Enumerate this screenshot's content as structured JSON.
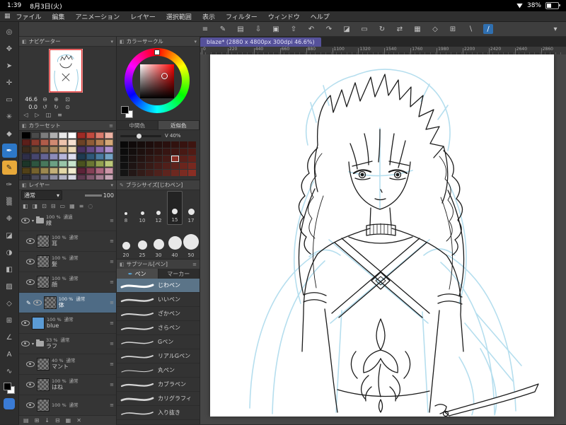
{
  "ui": {
    "chevron_down": "▾",
    "panel_icon": "◧",
    "menu_grid_icon": "▦",
    "list_icon": "≡",
    "dropdown_arrow": "▾",
    "pen_nib_icon": "✒",
    "pencil_icon": "✎"
  },
  "status_bar": {
    "time": "1:39",
    "date": "8月3日(火)",
    "battery_percent": "38%"
  },
  "menu_bar": {
    "items": [
      "ファイル",
      "編集",
      "アニメーション",
      "レイヤー",
      "選択範囲",
      "表示",
      "フィルター",
      "ウィンドウ",
      "ヘルプ"
    ]
  },
  "toolbar": {
    "icons": [
      {
        "name": "main-menu-icon",
        "glyph": "≡"
      },
      {
        "name": "pen-touch-toggle-icon",
        "glyph": "✎"
      },
      {
        "name": "new-canvas-icon",
        "glyph": "▤"
      },
      {
        "name": "import-icon",
        "glyph": "⇩"
      },
      {
        "name": "save-icon",
        "glyph": "▣"
      },
      {
        "name": "export-icon",
        "glyph": "⇧"
      },
      {
        "name": "undo-icon",
        "glyph": "↶"
      },
      {
        "name": "redo-icon",
        "glyph": "↷"
      },
      {
        "name": "clear-icon",
        "glyph": "◪"
      },
      {
        "name": "deselect-icon",
        "glyph": "▭"
      },
      {
        "name": "rotate-canvas-icon",
        "glyph": "↻"
      },
      {
        "name": "flip-canvas-icon",
        "glyph": "⇄"
      },
      {
        "name": "grid-icon",
        "glyph": "▦"
      },
      {
        "name": "snap-icon",
        "glyph": "◇"
      },
      {
        "name": "material-icon",
        "glyph": "⊞"
      },
      {
        "name": "line-tool-a-icon",
        "glyph": "∖"
      },
      {
        "name": "line-tool-b-icon",
        "glyph": "∕",
        "accent": true
      },
      {
        "name": "toolbar-expand-icon",
        "glyph": "▾",
        "right": true
      }
    ]
  },
  "document": {
    "tab_title": "blaze* (2880 x 4800px 300dpi 46.6%)"
  },
  "ruler": {
    "labels": [
      "0",
      "220",
      "440",
      "660",
      "880",
      "1100",
      "1320",
      "1540",
      "1760",
      "1980",
      "2200",
      "2420",
      "2640",
      "2860"
    ]
  },
  "left_toolbar": {
    "tools": [
      {
        "name": "zoom-tool",
        "glyph": "◎"
      },
      {
        "name": "move-canvas-tool",
        "glyph": "✥"
      },
      {
        "name": "operation-tool",
        "glyph": "➤"
      },
      {
        "name": "layer-move-tool",
        "glyph": "✛"
      },
      {
        "name": "selection-tool",
        "glyph": "▭"
      },
      {
        "name": "auto-select-tool",
        "glyph": "✳"
      },
      {
        "name": "eyedropper-tool",
        "glyph": "◆"
      },
      {
        "name": "pen-tool",
        "glyph": "✒",
        "active": "blue"
      },
      {
        "name": "pencil-tool",
        "glyph": "✎",
        "active": "yellow"
      },
      {
        "name": "brush-tool",
        "glyph": "✑"
      },
      {
        "name": "airbrush-tool",
        "glyph": "▒"
      },
      {
        "name": "decoration-tool",
        "glyph": "❉"
      },
      {
        "name": "eraser-tool",
        "glyph": "◪"
      },
      {
        "name": "blend-tool",
        "glyph": "◑"
      },
      {
        "name": "fill-tool",
        "glyph": "◧"
      },
      {
        "name": "gradient-tool",
        "glyph": "▨"
      },
      {
        "name": "figure-tool",
        "glyph": "◇"
      },
      {
        "name": "frame-border-tool",
        "glyph": "⊞"
      },
      {
        "name": "ruler-tool",
        "glyph": "∠"
      },
      {
        "name": "text-tool",
        "glyph": "A"
      },
      {
        "name": "line-correction-tool",
        "glyph": "∿"
      }
    ]
  },
  "navigator": {
    "title": "ナビゲーター",
    "zoom_value": "46.6",
    "rotate_value": "0.0",
    "zoom_icons": [
      "⊖",
      "⊕",
      "⊡"
    ],
    "rotate_icons": [
      "↺",
      "↻",
      "⊙"
    ],
    "extra_icons": [
      "◁",
      "▷",
      "◫",
      "≡"
    ]
  },
  "color_wheel": {
    "title": "カラーサークル"
  },
  "color_set": {
    "title": "カラーセット",
    "colors": [
      "#000000",
      "#4a4a4a",
      "#7d7d7d",
      "#b0b0b0",
      "#e8e8e8",
      "#ffffff",
      "#9e2b25",
      "#c14a3e",
      "#d97b6c",
      "#edb3a4",
      "#5c1f1a",
      "#8a3a2e",
      "#b05c4a",
      "#d08a72",
      "#ecc3ad",
      "#f5e0d0",
      "#6b4226",
      "#8f5d38",
      "#b37f52",
      "#d4a878",
      "#3a2a1c",
      "#5c4630",
      "#7e6548",
      "#a98a62",
      "#cfb288",
      "#ecd9b6",
      "#4a3260",
      "#664a85",
      "#8868aa",
      "#b192cc",
      "#2e2e48",
      "#46466e",
      "#646494",
      "#8c8cba",
      "#b6b6da",
      "#dedeef",
      "#1f3a50",
      "#2f5878",
      "#4a7ba0",
      "#74a3c4",
      "#1c3528",
      "#2e5540",
      "#48785c",
      "#6ca084",
      "#98c4a8",
      "#c8e4cc",
      "#4a521f",
      "#6b7633",
      "#93a050",
      "#bcc87a",
      "#514018",
      "#75622e",
      "#9c8850",
      "#c4b078",
      "#e4d8a8",
      "#f2ecd0",
      "#5c2338",
      "#844056",
      "#ac6880",
      "#cc96a8",
      "#2b2b33",
      "#4a4a58",
      "#6a6a7c",
      "#8e8ea2",
      "#b4b4c6",
      "#d8d8e4",
      "#5e3a50",
      "#80586e",
      "#a27c90",
      "#c4a4b4"
    ]
  },
  "mixer": {
    "tabs": [
      "中間色",
      "近似色"
    ],
    "active_tab": "近似色",
    "value_label": "V 40%",
    "grid_from": "#141414",
    "grid_to": "#8a2e24",
    "rows": 5,
    "cols": 9,
    "selected_row": 2,
    "selected_col": 6
  },
  "brush_size_panel": {
    "title": "ブラシサイズ[じわペン]",
    "sizes": [
      "8",
      "10",
      "12",
      "15",
      "17",
      "20",
      "25",
      "30",
      "40",
      "50"
    ],
    "selected": "15"
  },
  "subtool_panel": {
    "title": "サブツール[ペン]",
    "groups": [
      "ペン",
      "マーカー"
    ],
    "active_group": "ペン",
    "items": [
      "じわペン",
      "いいペン",
      "ざかペン",
      "さらペン",
      "Gペン",
      "リアルGペン",
      "丸ペン",
      "カブラペン",
      "カリグラフィ",
      "入り抜き"
    ],
    "selected": "じわペン"
  },
  "layers_panel": {
    "title": "レイヤー",
    "blend_mode": "通常",
    "opacity_value": "100",
    "header_icons": [
      "◧",
      "◨",
      "⊡",
      "⊟",
      "▭",
      "▦",
      "≡",
      "◌"
    ],
    "bottom_icons": [
      "▤",
      "⊞",
      "↓",
      "⊟",
      "▦",
      "✕"
    ],
    "rows": [
      {
        "name": "線",
        "opacity": "100 %",
        "mode": "通過",
        "kind": "folder",
        "expanded": true
      },
      {
        "name": "耳",
        "opacity": "100 %",
        "mode": "通常",
        "kind": "raster",
        "indent": true
      },
      {
        "name": "髪",
        "opacity": "100 %",
        "mode": "通常",
        "kind": "raster",
        "indent": true
      },
      {
        "name": "顔",
        "opacity": "100 %",
        "mode": "通常",
        "kind": "raster",
        "indent": true
      },
      {
        "name": "体",
        "opacity": "100 %",
        "mode": "通常",
        "kind": "raster",
        "indent": true,
        "selected": true,
        "editing": true
      },
      {
        "name": "blue",
        "opacity": "100 %",
        "mode": "通常",
        "kind": "fill",
        "fill": "#5b9bd5"
      },
      {
        "name": "ラフ",
        "opacity": "33 %",
        "mode": "通常",
        "kind": "folder",
        "expanded": true
      },
      {
        "name": "マント",
        "opacity": "40 %",
        "mode": "通常",
        "kind": "raster",
        "indent": true
      },
      {
        "name": "はね",
        "opacity": "100 %",
        "mode": "通常",
        "kind": "raster",
        "indent": true
      },
      {
        "name": "",
        "opacity": "100 %",
        "mode": "通常",
        "kind": "raster",
        "indent": true
      }
    ]
  }
}
